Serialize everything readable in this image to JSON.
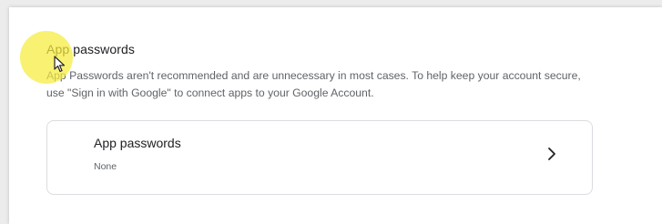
{
  "section": {
    "title": "App passwords",
    "description": "App Passwords aren't recommended and are unnecessary in most cases. To help keep your account secure, use \"Sign in with Google\" to connect apps to your Google Account."
  },
  "card": {
    "title": "App passwords",
    "value": "None",
    "action_icon": "chevron-right-icon"
  },
  "overlay": {
    "cursor_highlight_color": "#f5eb3c"
  }
}
